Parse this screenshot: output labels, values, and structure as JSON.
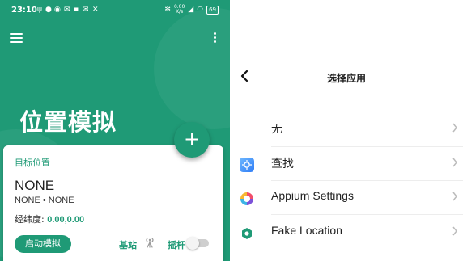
{
  "colors": {
    "accent": "#1f9a76",
    "card_bg": "#ffffff",
    "toggle_off": "#cfcfcf"
  },
  "status_bar": {
    "time": "23:10",
    "net_speed_value": "0.00",
    "net_speed_unit": "K/s",
    "battery": "69"
  },
  "app_bar": {
    "menu_icon": "hamburger-menu-icon",
    "more_icon": "more-vert-icon"
  },
  "main": {
    "title": "位置模拟",
    "fab_label": "+"
  },
  "card": {
    "target_label": "目标位置",
    "location_name": "NONE",
    "location_detail": "NONE • NONE",
    "coords_label": "经纬度:",
    "coords_value": "0.00,0.00",
    "start_button": "启动模拟",
    "base_station_label": "基站",
    "joystick_label": "摇杆",
    "joystick_enabled": false
  },
  "picker": {
    "title": "选择应用",
    "items": [
      {
        "label": "无",
        "icon": ""
      },
      {
        "label": "查找",
        "icon": "find-app-icon"
      },
      {
        "label": "Appium Settings",
        "icon": "appium-settings-icon"
      },
      {
        "label": "Fake Location",
        "icon": "fake-location-icon"
      }
    ]
  }
}
